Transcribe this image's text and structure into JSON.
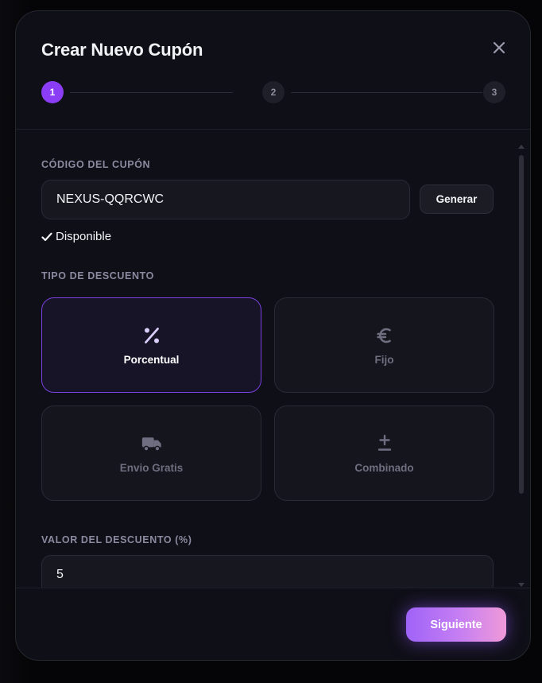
{
  "modal": {
    "title": "Crear Nuevo Cupón",
    "close_icon": "close-icon"
  },
  "stepper": {
    "steps": [
      {
        "label": "1",
        "state": "active"
      },
      {
        "label": "2",
        "state": "inactive"
      },
      {
        "label": "3",
        "state": "inactive"
      }
    ]
  },
  "coupon_code": {
    "label": "CÓDIGO DEL CUPÓN",
    "value": "NEXUS-QQRCWC",
    "generate_label": "Generar",
    "availability_text": "Disponible",
    "availability_icon": "check-icon"
  },
  "discount_type": {
    "label": "TIPO DE DESCUENTO",
    "options": [
      {
        "label": "Porcentual",
        "icon": "percent-icon",
        "selected": true
      },
      {
        "label": "Fijo",
        "icon": "euro-icon",
        "selected": false
      },
      {
        "label": "Envio Gratis",
        "icon": "truck-icon",
        "selected": false
      },
      {
        "label": "Combinado",
        "icon": "plus-minus-icon",
        "selected": false
      }
    ]
  },
  "discount_value": {
    "label": "VALOR DEL DESCUENTO (%)",
    "value": "5"
  },
  "footer": {
    "next_label": "Siguiente"
  },
  "colors": {
    "accent": "#8b3df5",
    "selected_border": "#7a40e0",
    "button_gradient_start": "#9f63f8",
    "button_gradient_end": "#ef9ad8"
  }
}
